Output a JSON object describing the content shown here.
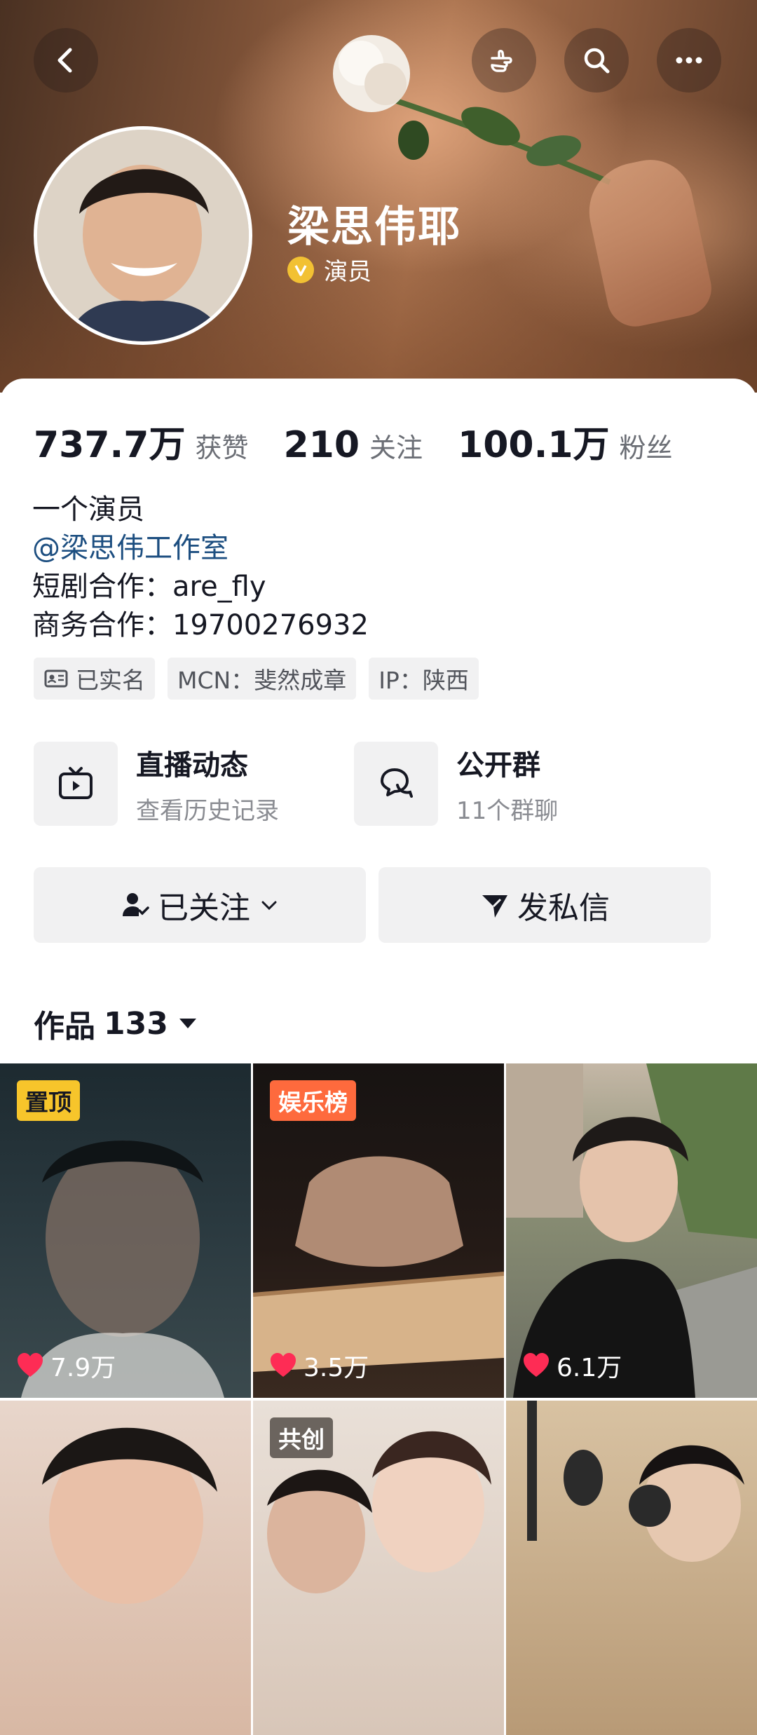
{
  "profile": {
    "name": "梁思伟耶",
    "verify_label": "演员"
  },
  "stats": [
    {
      "value": "737.7万",
      "label": "获赞"
    },
    {
      "value": "210",
      "label": "关注"
    },
    {
      "value": "100.1万",
      "label": "粉丝"
    }
  ],
  "bio": {
    "line1": "一个演员",
    "link": "@梁思伟工作室",
    "line3": "短剧合作：are_fly",
    "line4": "商务合作：19700276932"
  },
  "tags": {
    "verified": "已实名",
    "mcn": "MCN：斐然成章",
    "ip": "IP：陕西"
  },
  "features": {
    "live": {
      "title": "直播动态",
      "sub": "查看历史记录"
    },
    "group": {
      "title": "公开群",
      "sub": "11个群聊"
    }
  },
  "actions": {
    "follow": "已关注",
    "message": "发私信"
  },
  "works": {
    "label": "作品",
    "count": "133"
  },
  "videos": [
    {
      "badge": "置顶",
      "badge_color": "#f7c52b",
      "likes": "7.9万"
    },
    {
      "badge": "娱乐榜",
      "badge_color": "#fe6a3d",
      "likes": "3.5万"
    },
    {
      "badge": "",
      "badge_color": "",
      "likes": "6.1万"
    },
    {
      "badge": "",
      "badge_color": "",
      "likes": ""
    },
    {
      "badge": "共创",
      "badge_color": "#6b645e",
      "likes": ""
    },
    {
      "badge": "",
      "badge_color": "",
      "likes": ""
    }
  ],
  "colors": {
    "accent_link": "#1c4e80",
    "heart": "#fe2c55",
    "verify": "#f2c133"
  }
}
